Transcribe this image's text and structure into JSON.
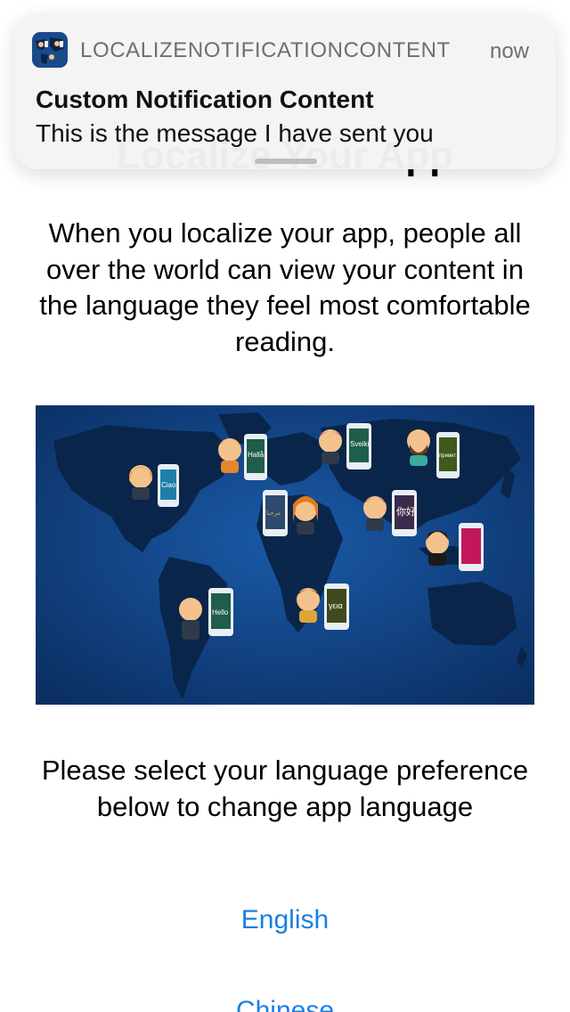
{
  "page": {
    "title": "Localize Your App",
    "intro": "When you localize your app, people all over the world can view your content in the language they feel most comfortable reading.",
    "prompt": "Please select your language preference below to change app language",
    "languages": [
      "English",
      "Chinese"
    ]
  },
  "map": {
    "background_color": "#0f3f7e",
    "greetings": [
      "Ciao",
      "Hallå",
      "Sveiki",
      "привет",
      "مرحبا",
      "你好",
      "Hello",
      "γεια"
    ]
  },
  "notification": {
    "app_name": "LOCALIZENOTIFICATIONCONTENT",
    "time": "now",
    "title": "Custom Notification Content",
    "body": "This is the message I have sent you"
  },
  "colors": {
    "link": "#1a7fe6",
    "notification_bg": "#f4f4f5",
    "secondary_text": "#6e6e73"
  }
}
